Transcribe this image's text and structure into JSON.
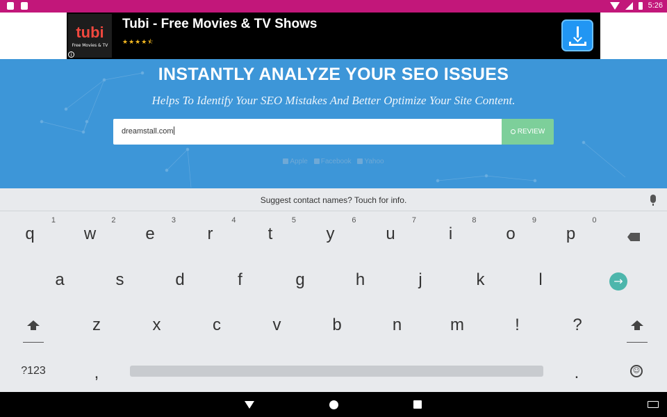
{
  "status_bar": {
    "time": "5:26"
  },
  "ad": {
    "brand": "tubi",
    "tagline": "Free Movies & TV",
    "title": "Tubi - Free Movies & TV Shows",
    "rating_stars": "★★★★⯪"
  },
  "hero": {
    "headline": "INSTANTLY ANALYZE YOUR SEO ISSUES",
    "subline": "Helps To Identify Your SEO Mistakes And Better Optimize Your Site Content.",
    "search_value": "dreamstall.com",
    "review_label": "REVIEW",
    "quick_links": [
      "Apple",
      "Facebook",
      "Yahoo"
    ]
  },
  "keyboard": {
    "suggestion": "Suggest contact names? Touch for info.",
    "row1": [
      {
        "letter": "q",
        "hint": "1"
      },
      {
        "letter": "w",
        "hint": "2"
      },
      {
        "letter": "e",
        "hint": "3"
      },
      {
        "letter": "r",
        "hint": "4"
      },
      {
        "letter": "t",
        "hint": "5"
      },
      {
        "letter": "y",
        "hint": "6"
      },
      {
        "letter": "u",
        "hint": "7"
      },
      {
        "letter": "i",
        "hint": "8"
      },
      {
        "letter": "o",
        "hint": "9"
      },
      {
        "letter": "p",
        "hint": "0"
      }
    ],
    "row2": [
      "a",
      "s",
      "d",
      "f",
      "g",
      "h",
      "j",
      "k",
      "l"
    ],
    "row3": [
      "z",
      "x",
      "c",
      "v",
      "b",
      "n",
      "m",
      "!",
      "?"
    ],
    "symbols_label": "?123",
    "comma": ",",
    "period": ".",
    "go_glyph": "→",
    "emoji_glyph": "☺"
  }
}
